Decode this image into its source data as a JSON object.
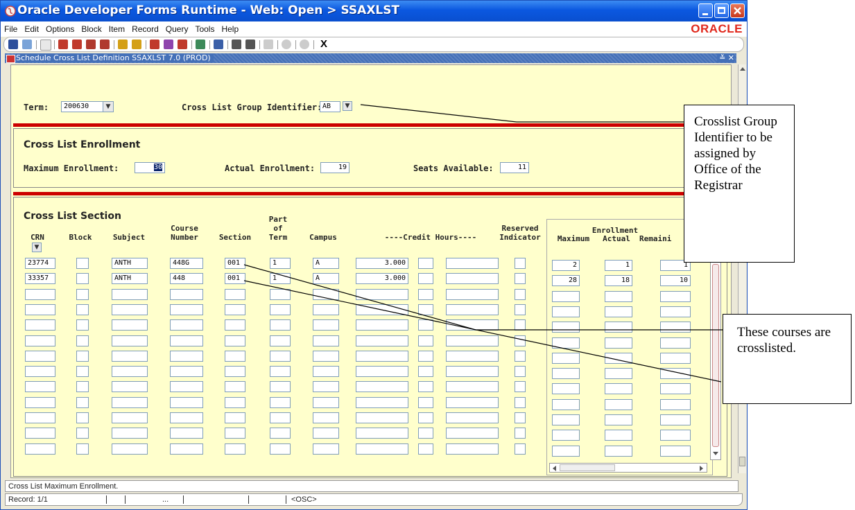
{
  "window": {
    "title": "Oracle Developer Forms Runtime - Web:  Open > SSAXLST",
    "logo": "ORACLE"
  },
  "menu": [
    "File",
    "Edit",
    "Options",
    "Block",
    "Item",
    "Record",
    "Query",
    "Tools",
    "Help"
  ],
  "toolbar": {
    "exit_label": "X"
  },
  "form": {
    "title": "Schedule Cross List Definition  SSAXLST  7.0  (PROD)",
    "controls": "≚ ✕"
  },
  "key_block": {
    "term_label": "Term:",
    "term_value": "200630",
    "group_label": "Cross List Group Identifier:",
    "group_value": "AB"
  },
  "enrollment": {
    "section_title": "Cross List Enrollment",
    "max_label": "Maximum Enrollment:",
    "max_value": "30",
    "actual_label": "Actual Enrollment:",
    "actual_value": "19",
    "seats_label": "Seats Available:",
    "seats_value": "11"
  },
  "section": {
    "title": "Cross List Section",
    "headers": {
      "crn": "CRN",
      "block": "Block",
      "subject": "Subject",
      "course_number": "Course\nNumber",
      "section": "Section",
      "part_of_term": "Part\nof\nTerm",
      "campus": "Campus",
      "credit_hours": "----Credit Hours----",
      "reserved": "Reserved\nIndicator",
      "enrollment": "Enrollment",
      "maximum": "Maximum",
      "actual": "Actual",
      "remaining": "Remaini"
    },
    "rows": [
      {
        "crn": "23774",
        "block": "",
        "subject": "ANTH",
        "course": "448G",
        "section": "001",
        "part": "1",
        "campus": "A",
        "credit": "3.000",
        "max": "2",
        "actual": "1",
        "remaining": "1"
      },
      {
        "crn": "33357",
        "block": "",
        "subject": "ANTH",
        "course": "448",
        "section": "001",
        "part": "1",
        "campus": "A",
        "credit": "3.000",
        "max": "28",
        "actual": "18",
        "remaining": "10"
      },
      {
        "crn": "",
        "block": "",
        "subject": "",
        "course": "",
        "section": "",
        "part": "",
        "campus": "",
        "credit": "",
        "max": "",
        "actual": "",
        "remaining": ""
      },
      {
        "crn": "",
        "block": "",
        "subject": "",
        "course": "",
        "section": "",
        "part": "",
        "campus": "",
        "credit": "",
        "max": "",
        "actual": "",
        "remaining": ""
      },
      {
        "crn": "",
        "block": "",
        "subject": "",
        "course": "",
        "section": "",
        "part": "",
        "campus": "",
        "credit": "",
        "max": "",
        "actual": "",
        "remaining": ""
      },
      {
        "crn": "",
        "block": "",
        "subject": "",
        "course": "",
        "section": "",
        "part": "",
        "campus": "",
        "credit": "",
        "max": "",
        "actual": "",
        "remaining": ""
      },
      {
        "crn": "",
        "block": "",
        "subject": "",
        "course": "",
        "section": "",
        "part": "",
        "campus": "",
        "credit": "",
        "max": "",
        "actual": "",
        "remaining": ""
      },
      {
        "crn": "",
        "block": "",
        "subject": "",
        "course": "",
        "section": "",
        "part": "",
        "campus": "",
        "credit": "",
        "max": "",
        "actual": "",
        "remaining": ""
      },
      {
        "crn": "",
        "block": "",
        "subject": "",
        "course": "",
        "section": "",
        "part": "",
        "campus": "",
        "credit": "",
        "max": "",
        "actual": "",
        "remaining": ""
      },
      {
        "crn": "",
        "block": "",
        "subject": "",
        "course": "",
        "section": "",
        "part": "",
        "campus": "",
        "credit": "",
        "max": "",
        "actual": "",
        "remaining": ""
      },
      {
        "crn": "",
        "block": "",
        "subject": "",
        "course": "",
        "section": "",
        "part": "",
        "campus": "",
        "credit": "",
        "max": "",
        "actual": "",
        "remaining": ""
      },
      {
        "crn": "",
        "block": "",
        "subject": "",
        "course": "",
        "section": "",
        "part": "",
        "campus": "",
        "credit": "",
        "max": "",
        "actual": "",
        "remaining": ""
      },
      {
        "crn": "",
        "block": "",
        "subject": "",
        "course": "",
        "section": "",
        "part": "",
        "campus": "",
        "credit": "",
        "max": "",
        "actual": "",
        "remaining": ""
      }
    ]
  },
  "status": {
    "message": "Cross List Maximum Enrollment.",
    "record": "Record: 1/1",
    "ellipsis": "...",
    "mode": "<OSC>"
  },
  "callouts": {
    "group_note": "Crosslist Group Identifier to be assigned by Office of the Registrar",
    "crosslist_note": "These courses are crosslisted."
  },
  "colors": {
    "title_blue": "#0b58e0",
    "form_bg": "#ffffcc",
    "red_bar": "#cc0000",
    "oracle_red": "#e0271b"
  }
}
